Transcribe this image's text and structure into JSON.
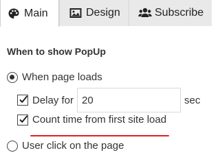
{
  "tabs": [
    {
      "label": "Main",
      "icon": "palette-icon",
      "active": true
    },
    {
      "label": "Design",
      "icon": "image-icon",
      "active": false
    },
    {
      "label": "Subscribe",
      "icon": "users-icon",
      "active": false
    }
  ],
  "section_title": "When to show PopUp",
  "options": {
    "page_load_label": "When page loads",
    "page_load_selected": true,
    "delay_label": "Delay for",
    "delay_checked": true,
    "delay_value": "20",
    "delay_unit": "sec",
    "count_time_label": "Count time from first site load",
    "count_time_checked": true,
    "click_label": "User click on the page",
    "click_selected": false
  },
  "colors": {
    "highlight_underline": "#e0201c",
    "active_tab_bg": "#ffffff",
    "inactive_tab_bg": "#e9e9e9"
  }
}
